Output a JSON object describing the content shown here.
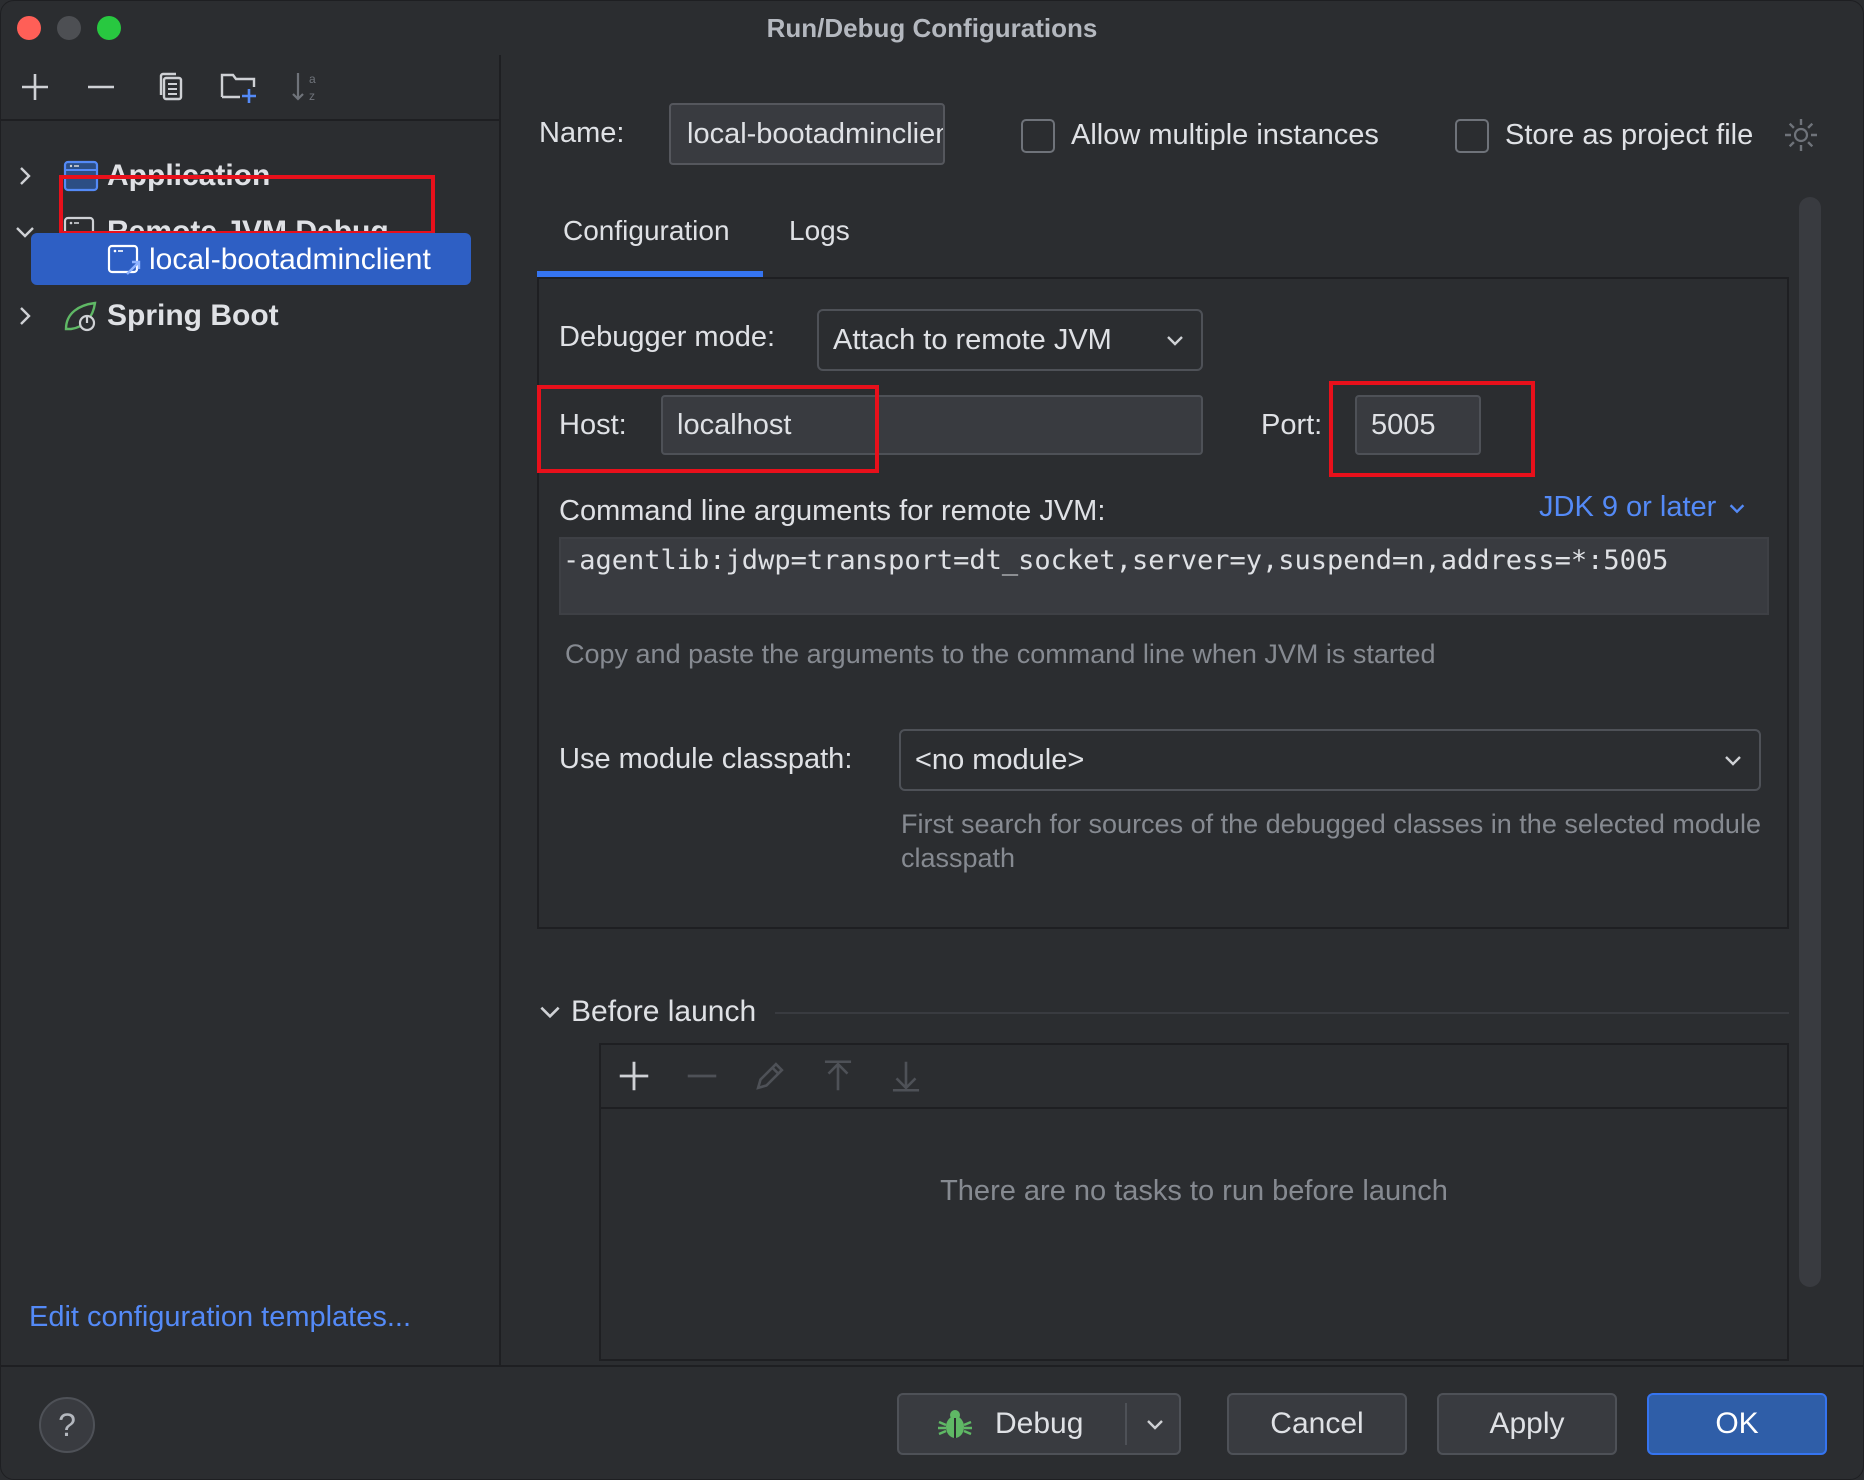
{
  "window": {
    "title": "Run/Debug Configurations"
  },
  "sidebar": {
    "items": [
      {
        "label": "Application",
        "expanded": false,
        "level": 0
      },
      {
        "label": "Remote JVM Debug",
        "expanded": true,
        "level": 0,
        "highlighted": true
      },
      {
        "label": "local-bootadminclient",
        "level": 1,
        "selected": true
      },
      {
        "label": "Spring Boot",
        "expanded": false,
        "level": 0
      }
    ],
    "edit_templates_link": "Edit configuration templates..."
  },
  "form": {
    "name_label": "Name:",
    "name_value": "local-bootadminclient",
    "allow_multiple_label": "Allow multiple instances",
    "allow_multiple_checked": false,
    "store_project_label": "Store as project file",
    "store_project_checked": false
  },
  "tabs": [
    {
      "label": "Configuration",
      "active": true
    },
    {
      "label": "Logs",
      "active": false
    }
  ],
  "config": {
    "debugger_mode_label": "Debugger mode:",
    "debugger_mode_value": "Attach to remote JVM",
    "host_label": "Host:",
    "host_value": "localhost",
    "port_label": "Port:",
    "port_value": "5005",
    "cmd_label": "Command line arguments for remote JVM:",
    "jdk_link": "JDK 9 or later",
    "cmd_value": "-agentlib:jdwp=transport=dt_socket,server=y,suspend=n,address=*:5005",
    "cmd_hint": "Copy and paste the arguments to the command line when JVM is started",
    "module_label": "Use module classpath:",
    "module_value": "<no module>",
    "module_hint": "First search for sources of the debugged classes in the selected module classpath"
  },
  "before_launch": {
    "label": "Before launch",
    "empty_text": "There are no tasks to run before launch"
  },
  "footer": {
    "help": "?",
    "debug_label": "Debug",
    "cancel_label": "Cancel",
    "apply_label": "Apply",
    "ok_label": "OK"
  },
  "colors": {
    "accent": "#3574f0",
    "link": "#548af7",
    "highlight_box": "#e8101b",
    "background": "#2b2d30"
  }
}
